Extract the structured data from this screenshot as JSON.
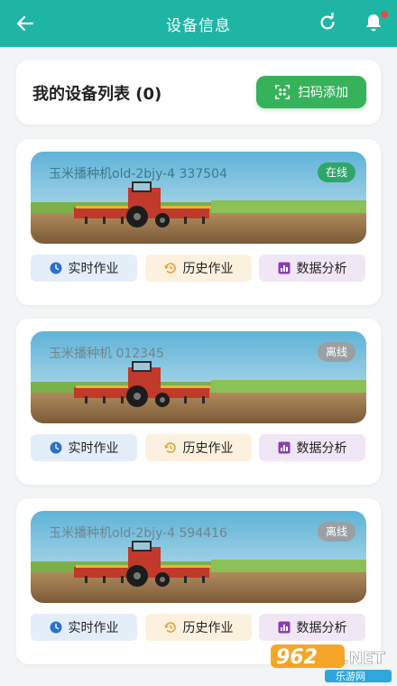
{
  "topbar": {
    "title": "设备信息",
    "back_icon": "arrow-left-icon",
    "refresh_icon": "refresh-icon",
    "bell_icon": "bell-icon",
    "background": "#1fb5a4"
  },
  "list_header": {
    "title": "我的设备列表 (0)",
    "scan_button_label": "扫码添加",
    "scan_icon": "scan-icon",
    "button_color": "#36b25a"
  },
  "devices": [
    {
      "name": "玉米播种机old-2bjy-4 337504",
      "status": "在线",
      "online": true
    },
    {
      "name": "玉米播种机 012345",
      "status": "离线",
      "online": false
    },
    {
      "name": "玉米播种机old-2bjy-4 594416",
      "status": "离线",
      "online": false
    }
  ],
  "actions": {
    "realtime_label": "实时作业",
    "history_label": "历史作业",
    "analysis_label": "数据分析",
    "realtime_icon": "clock-icon",
    "history_icon": "history-icon",
    "analysis_icon": "bar-chart-icon"
  },
  "status_colors": {
    "online": "#2fa66a",
    "offline": "#9aa0a4"
  },
  "watermark": {
    "number": "962",
    "suffix": ".NET",
    "caption": "乐游网"
  }
}
